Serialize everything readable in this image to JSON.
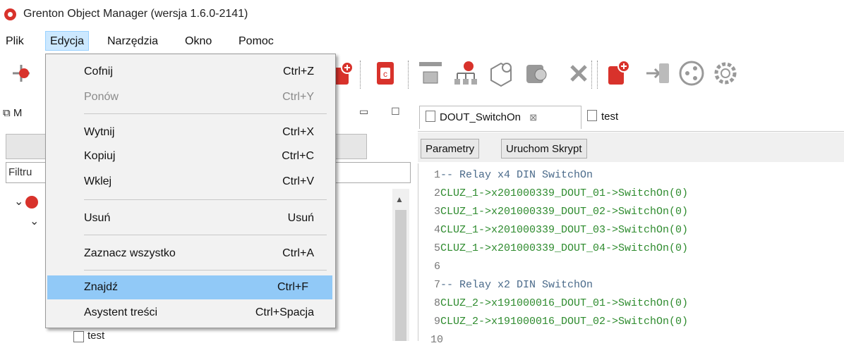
{
  "app": {
    "title": "Grenton Object Manager (wersja 1.6.0-2141)"
  },
  "menubar": {
    "items": [
      {
        "label": "Plik"
      },
      {
        "label": "Edycja",
        "active": true
      },
      {
        "label": "Narzędzia"
      },
      {
        "label": "Okno"
      },
      {
        "label": "Pomoc"
      }
    ]
  },
  "edit_menu": {
    "items": [
      {
        "label": "Cofnij",
        "shortcut": "Ctrl+Z",
        "enabled": true
      },
      {
        "label": "Ponów",
        "shortcut": "Ctrl+Y",
        "enabled": false
      },
      {
        "label": "Wytnij",
        "shortcut": "Ctrl+X",
        "enabled": true
      },
      {
        "label": "Kopiuj",
        "shortcut": "Ctrl+C",
        "enabled": true
      },
      {
        "label": "Wklej",
        "shortcut": "Ctrl+V",
        "enabled": true
      },
      {
        "label": "Usuń",
        "shortcut": "Usuń",
        "enabled": true
      },
      {
        "label": "Zaznacz wszystko",
        "shortcut": "Ctrl+A",
        "enabled": true
      },
      {
        "label": "Znajdź",
        "shortcut": "Ctrl+F",
        "enabled": true,
        "highlighted": true
      },
      {
        "label": "Asystent treści",
        "shortcut": "Ctrl+Spacja",
        "enabled": true
      }
    ]
  },
  "left_panel": {
    "tab_label": "M",
    "filter_label": "Filtru",
    "tree_item_label": "test"
  },
  "editor": {
    "tabs": [
      {
        "label": "DOUT_SwitchOn",
        "active": true,
        "close": "⊠"
      },
      {
        "label": "test",
        "active": false
      }
    ],
    "buttons": {
      "params": "Parametry",
      "run": "Uruchom Skrypt"
    },
    "lines": [
      {
        "n": "1",
        "text": "-- Relay x4 DIN SwitchOn",
        "kind": "comment"
      },
      {
        "n": "2",
        "text": "CLUZ_1->x201000339_DOUT_01->SwitchOn(0)",
        "kind": "code"
      },
      {
        "n": "3",
        "text": "CLUZ_1->x201000339_DOUT_02->SwitchOn(0)",
        "kind": "code"
      },
      {
        "n": "4",
        "text": "CLUZ_1->x201000339_DOUT_03->SwitchOn(0)",
        "kind": "code"
      },
      {
        "n": "5",
        "text": "CLUZ_1->x201000339_DOUT_04->SwitchOn(0)",
        "kind": "code"
      },
      {
        "n": "6",
        "text": "",
        "kind": "code"
      },
      {
        "n": "7",
        "text": "-- Relay x2 DIN SwitchOn",
        "kind": "comment"
      },
      {
        "n": "8",
        "text": "CLUZ_2->x191000016_DOUT_01->SwitchOn(0)",
        "kind": "code"
      },
      {
        "n": "9",
        "text": "CLUZ_2->x191000016_DOUT_02->SwitchOn(0)",
        "kind": "code"
      },
      {
        "n": "10",
        "text": "",
        "kind": "code"
      }
    ]
  },
  "colors": {
    "brand": "#d8322b",
    "menu_highlight": "#91c9f7",
    "code_green": "#2e8b2e",
    "comment": "#4a6a8a"
  },
  "toolbar": {
    "icons": [
      "add-object-icon",
      "new-script-icon",
      "cloud-script-icon",
      "module-icon",
      "hierarchy-icon",
      "cube-icon",
      "clu-connect-icon",
      "remove-icon",
      "add-device-icon",
      "import-icon",
      "share-icon",
      "settings-icon"
    ]
  }
}
